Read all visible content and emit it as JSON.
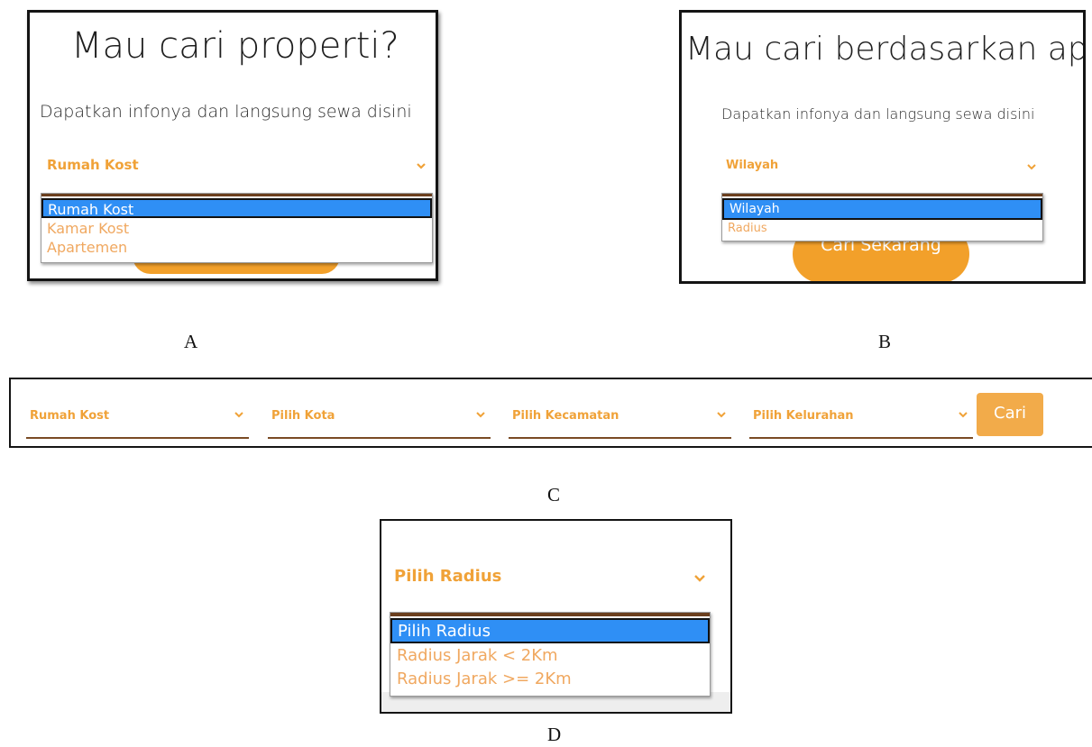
{
  "panels": {
    "a": {
      "label": "A",
      "title": "Mau cari properti?",
      "subtitle": "Dapatkan infonya dan langsung sewa disini",
      "select_value": "Rumah Kost",
      "options": [
        "Rumah Kost",
        "Kamar Kost",
        "Apartemen"
      ]
    },
    "b": {
      "label": "B",
      "title": "Mau cari berdasarkan apa?",
      "subtitle": "Dapatkan infonya dan langsung sewa disini",
      "select_value": "Wilayah",
      "options": [
        "Wilayah",
        "Radius"
      ],
      "button_label": "Cari Sekarang"
    },
    "c": {
      "label": "C",
      "fields": [
        "Rumah Kost",
        "Pilih Kota",
        "Pilih Kecamatan",
        "Pilih Kelurahan"
      ],
      "button_label": "Cari"
    },
    "d": {
      "label": "D",
      "select_value": "Pilih Radius",
      "options": [
        "Pilih Radius",
        "Radius Jarak < 2Km",
        "Radius Jarak >= 2Km"
      ]
    }
  },
  "colors": {
    "accent_orange": "#f0a238",
    "button_orange": "#f2a02a",
    "selected_blue": "#2f8ff5",
    "underline_brown": "#7a4b25"
  },
  "icons": {
    "chevron": "chevron-down-icon"
  }
}
